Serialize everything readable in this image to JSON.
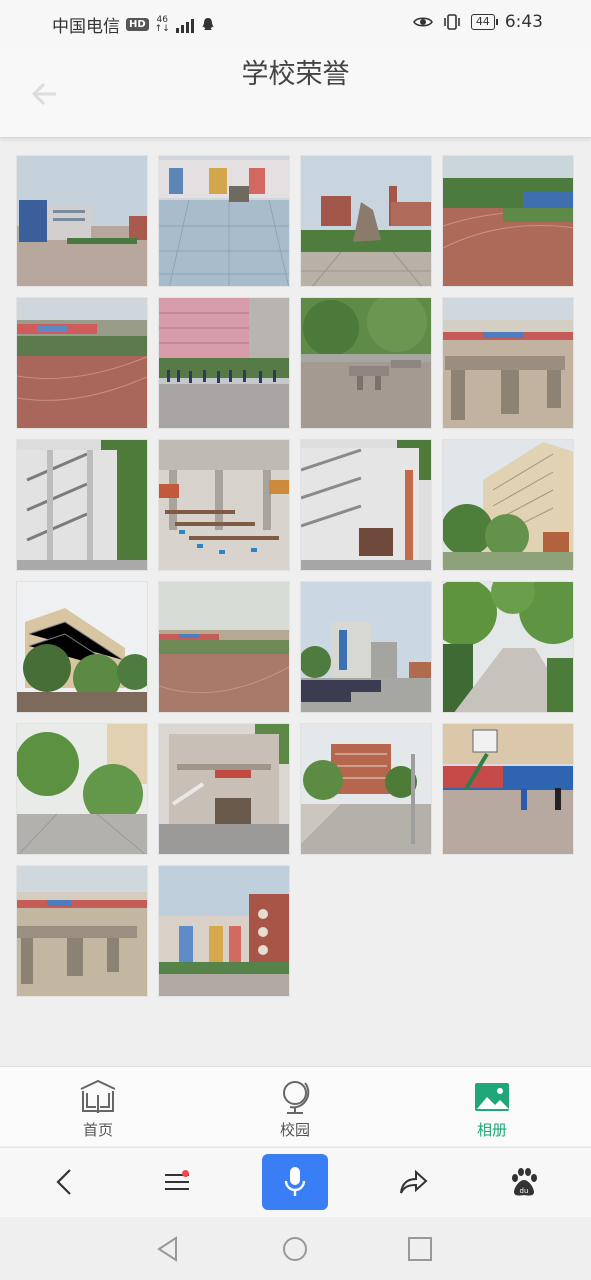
{
  "status": {
    "carrier": "中国电信",
    "hd": "HD",
    "network": "46",
    "battery": "44",
    "time": "6:43"
  },
  "header": {
    "title": "学校荣誉"
  },
  "gallery": {
    "photos": [
      {
        "name": "photo-1",
        "desc": "campus-plaza-buildings"
      },
      {
        "name": "photo-2",
        "desc": "colorful-building-tiled-plaza"
      },
      {
        "name": "photo-3",
        "desc": "sculpture-garden"
      },
      {
        "name": "photo-4",
        "desc": "running-track"
      },
      {
        "name": "photo-5",
        "desc": "sports-field-track"
      },
      {
        "name": "photo-6",
        "desc": "students-pink-building"
      },
      {
        "name": "photo-7",
        "desc": "pingpong-tables-trees"
      },
      {
        "name": "photo-8",
        "desc": "concrete-tables"
      },
      {
        "name": "photo-9",
        "desc": "staircase-building"
      },
      {
        "name": "photo-10",
        "desc": "cafeteria-interior"
      },
      {
        "name": "photo-11",
        "desc": "building-entrance-stairs"
      },
      {
        "name": "photo-12",
        "desc": "dormitory-trees"
      },
      {
        "name": "photo-13",
        "desc": "dormitory-building"
      },
      {
        "name": "photo-14",
        "desc": "empty-field"
      },
      {
        "name": "photo-15",
        "desc": "bicycle-parking"
      },
      {
        "name": "photo-16",
        "desc": "tree-lined-path"
      },
      {
        "name": "photo-17",
        "desc": "street-trees"
      },
      {
        "name": "photo-18",
        "desc": "hall-building"
      },
      {
        "name": "photo-19",
        "desc": "campus-road"
      },
      {
        "name": "photo-20",
        "desc": "basketball-court"
      },
      {
        "name": "photo-21",
        "desc": "outdoor-tables"
      },
      {
        "name": "photo-22",
        "desc": "colorful-building"
      }
    ]
  },
  "tabbar": {
    "tabs": [
      {
        "label": "首页",
        "icon": "book-icon"
      },
      {
        "label": "校园",
        "icon": "globe-icon"
      },
      {
        "label": "相册",
        "icon": "picture-icon"
      }
    ]
  },
  "colors": {
    "accent": "#1fa77a",
    "mic": "#3a7ef5"
  }
}
